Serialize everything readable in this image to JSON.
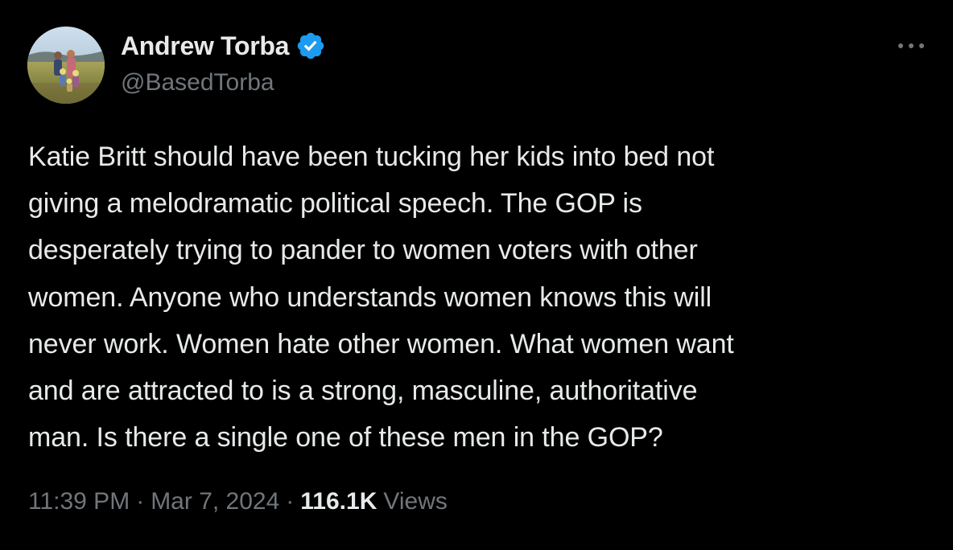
{
  "author": {
    "display_name": "Andrew Torba",
    "handle": "@BasedTorba",
    "verified": true,
    "avatar_icon": "profile-photo",
    "verified_icon": "verified-check-icon",
    "verified_color": "#1d9bf0"
  },
  "more_icon": "more-options-icon",
  "tweet": {
    "text_lines": [
      "Katie Britt should have been tucking her kids into bed not",
      "giving a melodramatic political speech. The GOP is",
      "desperately trying to pander to women voters with other",
      "women. Anyone who understands women knows this will",
      "never work. Women hate other women. What women want",
      "and are attracted to is a strong, masculine, authoritative",
      "man. Is there a single one of these men in the GOP?"
    ]
  },
  "meta": {
    "time": "11:39 PM",
    "separator": "·",
    "date": "Mar 7, 2024",
    "views_count": "116.1K",
    "views_label": "Views"
  },
  "colors": {
    "background": "#000000",
    "primary_text": "#e7e9ea",
    "secondary_text": "#71767b"
  }
}
